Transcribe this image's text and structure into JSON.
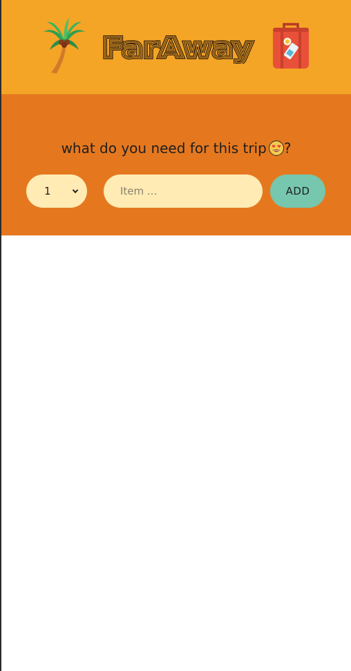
{
  "header": {
    "title": "FarAway",
    "left_icon": "palm-tree-icon",
    "right_icon": "luggage-icon"
  },
  "form": {
    "prompt": "what do you need for this trip",
    "prompt_suffix": "?",
    "prompt_icon": "heart-eyes-emoji",
    "quantity_value": "1",
    "item_placeholder": "Item ...",
    "add_label": "ADD"
  },
  "colors": {
    "header_bg": "#f4a526",
    "form_bg": "#e5781f",
    "field_bg": "#ffebb3",
    "add_button_bg": "#76c7ad"
  }
}
